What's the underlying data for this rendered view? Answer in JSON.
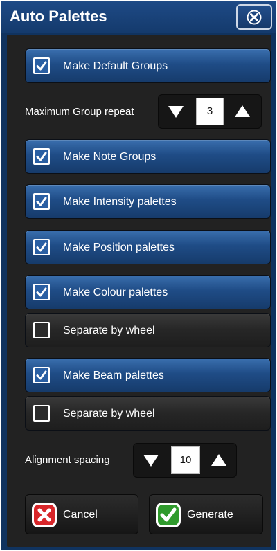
{
  "window": {
    "title": "Auto Palettes",
    "close_icon": "close-x-icon"
  },
  "options": [
    {
      "label": "Make Default Groups",
      "checked": true
    },
    {
      "label": "Make Note Groups",
      "checked": true
    },
    {
      "label": "Make Intensity palettes",
      "checked": true
    },
    {
      "label": "Make Position palettes",
      "checked": true
    },
    {
      "label": "Make Colour palettes",
      "checked": true
    },
    {
      "label": "Separate by wheel",
      "checked": false
    },
    {
      "label": "Make Beam palettes",
      "checked": true
    },
    {
      "label": "Separate by wheel",
      "checked": false
    }
  ],
  "group_repeat": {
    "label": "Maximum Group repeat",
    "value": "3",
    "decrement_icon": "triangle-down-icon",
    "increment_icon": "triangle-up-icon"
  },
  "alignment": {
    "label": "Alignment spacing",
    "value": "10",
    "decrement_icon": "triangle-down-icon",
    "increment_icon": "triangle-up-icon"
  },
  "actions": {
    "cancel_label": "Cancel",
    "generate_label": "Generate",
    "cancel_icon": "red-x-icon",
    "generate_icon": "green-check-icon"
  },
  "colors": {
    "title_bar": "#1a4279",
    "panel": "#222222",
    "toggle_on": "#1f4c86",
    "toggle_off": "#262626",
    "cancel_red": "#d8262a",
    "generate_green": "#2f9a2c"
  }
}
